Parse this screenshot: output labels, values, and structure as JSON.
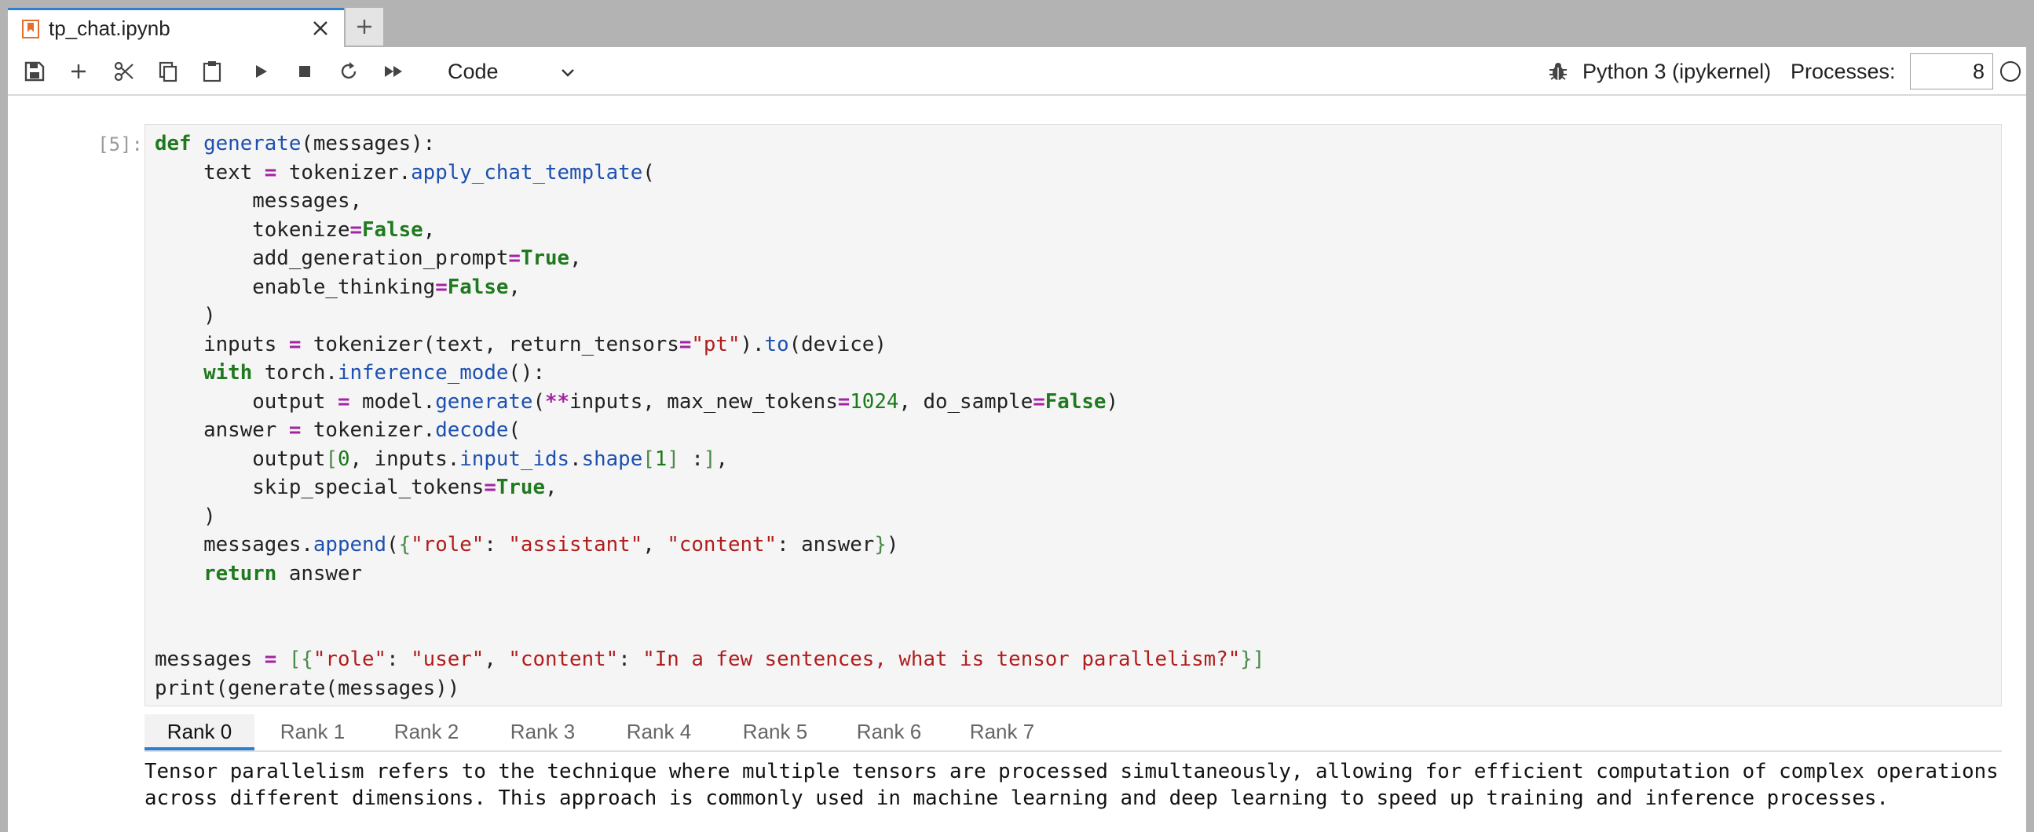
{
  "tab": {
    "title": "tp_chat.ipynb",
    "icon": "notebook-icon"
  },
  "toolbar": {
    "buttons": [
      "save-icon",
      "add-icon",
      "cut-icon",
      "copy-icon",
      "paste-icon",
      "run-icon",
      "stop-icon",
      "restart-icon",
      "fast-forward-icon"
    ],
    "cell_type": "Code",
    "kernel_name": "Python 3 (ipykernel)",
    "processes_label": "Processes:",
    "processes_value": "8"
  },
  "cell": {
    "prompt": "[5]:",
    "code_lines": [
      "def generate(messages):",
      "    text = tokenizer.apply_chat_template(",
      "        messages,",
      "        tokenize=False,",
      "        add_generation_prompt=True,",
      "        enable_thinking=False,",
      "    )",
      "    inputs = tokenizer(text, return_tensors=\"pt\").to(device)",
      "    with torch.inference_mode():",
      "        output = model.generate(**inputs, max_new_tokens=1024, do_sample=False)",
      "    answer = tokenizer.decode(",
      "        output[0, inputs.input_ids.shape[1] :],",
      "        skip_special_tokens=True,",
      "    )",
      "    messages.append({\"role\": \"assistant\", \"content\": answer})",
      "    return answer",
      "",
      "",
      "messages = [{\"role\": \"user\", \"content\": \"In a few sentences, what is tensor parallelism?\"}]",
      "print(generate(messages))"
    ]
  },
  "output": {
    "tabs": [
      "Rank 0",
      "Rank 1",
      "Rank 2",
      "Rank 3",
      "Rank 4",
      "Rank 5",
      "Rank 6",
      "Rank 7"
    ],
    "active_tab": "Rank 0",
    "text": "Tensor parallelism refers to the technique where multiple tensors are processed simultaneously, allowing for efficient computation of complex operations across different dimensions. This approach is commonly used in machine learning and deep learning to speed up training and inference processes."
  },
  "colors": {
    "accent": "#2f7fd0",
    "keyword": "#1f7a1f",
    "function": "#1d50b0",
    "operator": "#a324a3",
    "string": "#b01d1d"
  }
}
